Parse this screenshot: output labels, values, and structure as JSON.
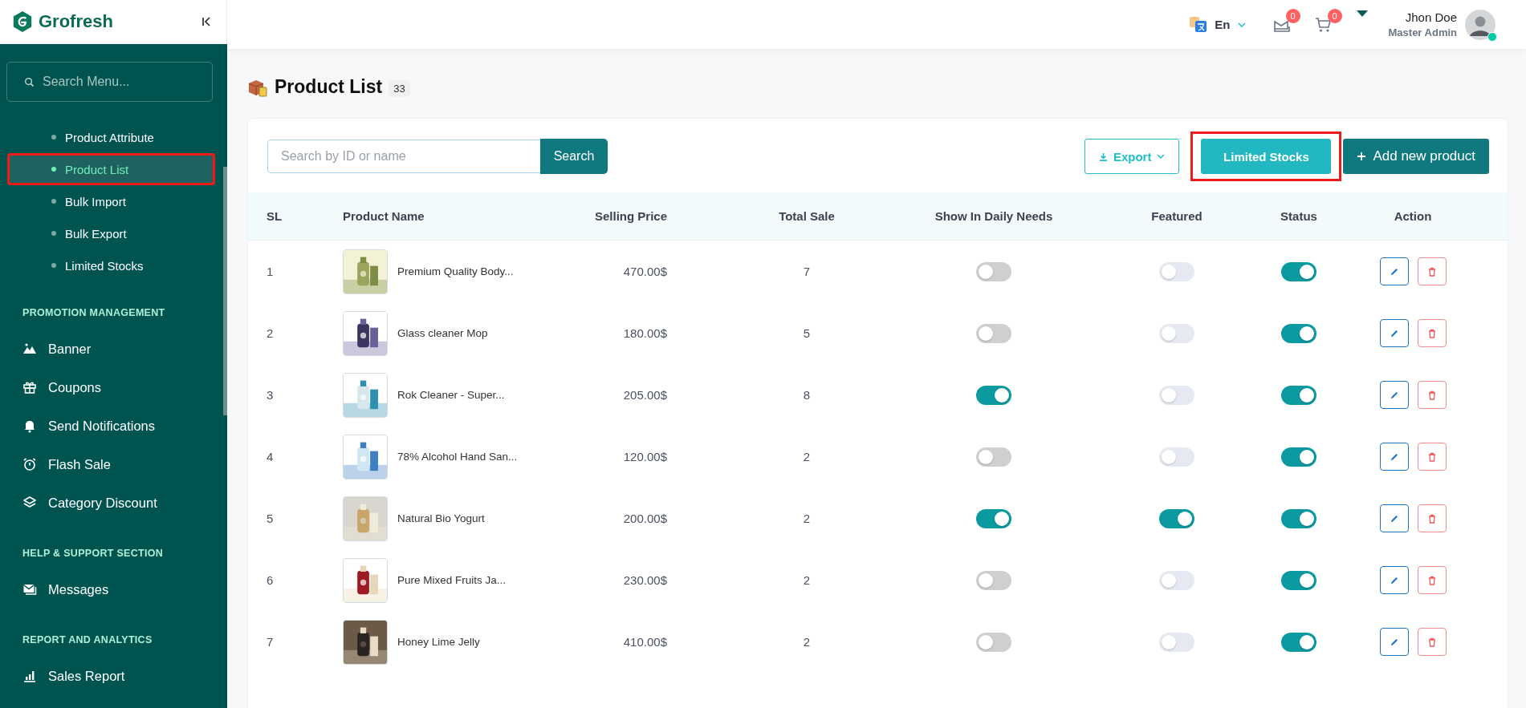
{
  "brand": {
    "name": "Grofresh"
  },
  "sidebar": {
    "search": {
      "placeholder": "Search Menu..."
    },
    "sections": [
      {
        "items": [
          {
            "label": "Product Attribute",
            "selected": false,
            "annotated": false
          },
          {
            "label": "Product List",
            "selected": true,
            "annotated": true
          },
          {
            "label": "Bulk Import",
            "selected": false,
            "annotated": false
          },
          {
            "label": "Bulk Export",
            "selected": false,
            "annotated": false
          },
          {
            "label": "Limited Stocks",
            "selected": false,
            "annotated": false
          }
        ],
        "kind": "sub"
      },
      {
        "heading": "PROMOTION MANAGEMENT",
        "kind": "main",
        "items": [
          {
            "label": "Banner",
            "selected": false,
            "annotated": false
          },
          {
            "label": "Coupons",
            "selected": false,
            "annotated": false
          },
          {
            "label": "Send Notifications",
            "selected": false,
            "annotated": false
          },
          {
            "label": "Flash Sale",
            "selected": false,
            "annotated": false
          },
          {
            "label": "Category Discount",
            "selected": false,
            "annotated": false
          }
        ]
      },
      {
        "heading": "HELP & SUPPORT SECTION",
        "kind": "main",
        "items": [
          {
            "label": "Messages",
            "selected": false,
            "annotated": false
          }
        ]
      },
      {
        "heading": "REPORT AND ANALYTICS",
        "kind": "main",
        "items": [
          {
            "label": "Sales Report",
            "selected": false,
            "annotated": false
          }
        ]
      }
    ]
  },
  "topbar": {
    "language": "En",
    "message_count": "0",
    "cart_count": "0",
    "user_name": "Jhon Doe",
    "user_role": "Master Admin",
    "online": true
  },
  "page": {
    "title": "Product List",
    "count": "33"
  },
  "toolbar": {
    "search": {
      "placeholder": "Search by ID or name"
    },
    "search_button": "Search",
    "export_button": "Export",
    "limited_button": {
      "label": "Limited Stocks",
      "annotated": true
    },
    "add_button": "Add new product"
  },
  "table": {
    "columns": [
      "SL",
      "Product Name",
      "Selling Price",
      "Total Sale",
      "Show In Daily Needs",
      "Featured",
      "Status",
      "Action"
    ],
    "rows": [
      {
        "sl": "1",
        "name": "Premium Quality Body...",
        "price": "470.00$",
        "total_sale": "7",
        "daily_needs": false,
        "featured": false,
        "status": true
      },
      {
        "sl": "2",
        "name": "Glass cleaner Mop",
        "price": "180.00$",
        "total_sale": "5",
        "daily_needs": false,
        "featured": false,
        "status": true
      },
      {
        "sl": "3",
        "name": "Rok Cleaner - Super...",
        "price": "205.00$",
        "total_sale": "8",
        "daily_needs": true,
        "featured": false,
        "status": true
      },
      {
        "sl": "4",
        "name": "78% Alcohol Hand San...",
        "price": "120.00$",
        "total_sale": "2",
        "daily_needs": false,
        "featured": false,
        "status": true
      },
      {
        "sl": "5",
        "name": "Natural Bio Yogurt",
        "price": "200.00$",
        "total_sale": "2",
        "daily_needs": true,
        "featured": true,
        "status": true
      },
      {
        "sl": "6",
        "name": "Pure Mixed Fruits Ja...",
        "price": "230.00$",
        "total_sale": "2",
        "daily_needs": false,
        "featured": false,
        "status": true
      },
      {
        "sl": "7",
        "name": "Honey Lime Jelly",
        "price": "410.00$",
        "total_sale": "2",
        "daily_needs": false,
        "featured": false,
        "status": true
      }
    ]
  }
}
